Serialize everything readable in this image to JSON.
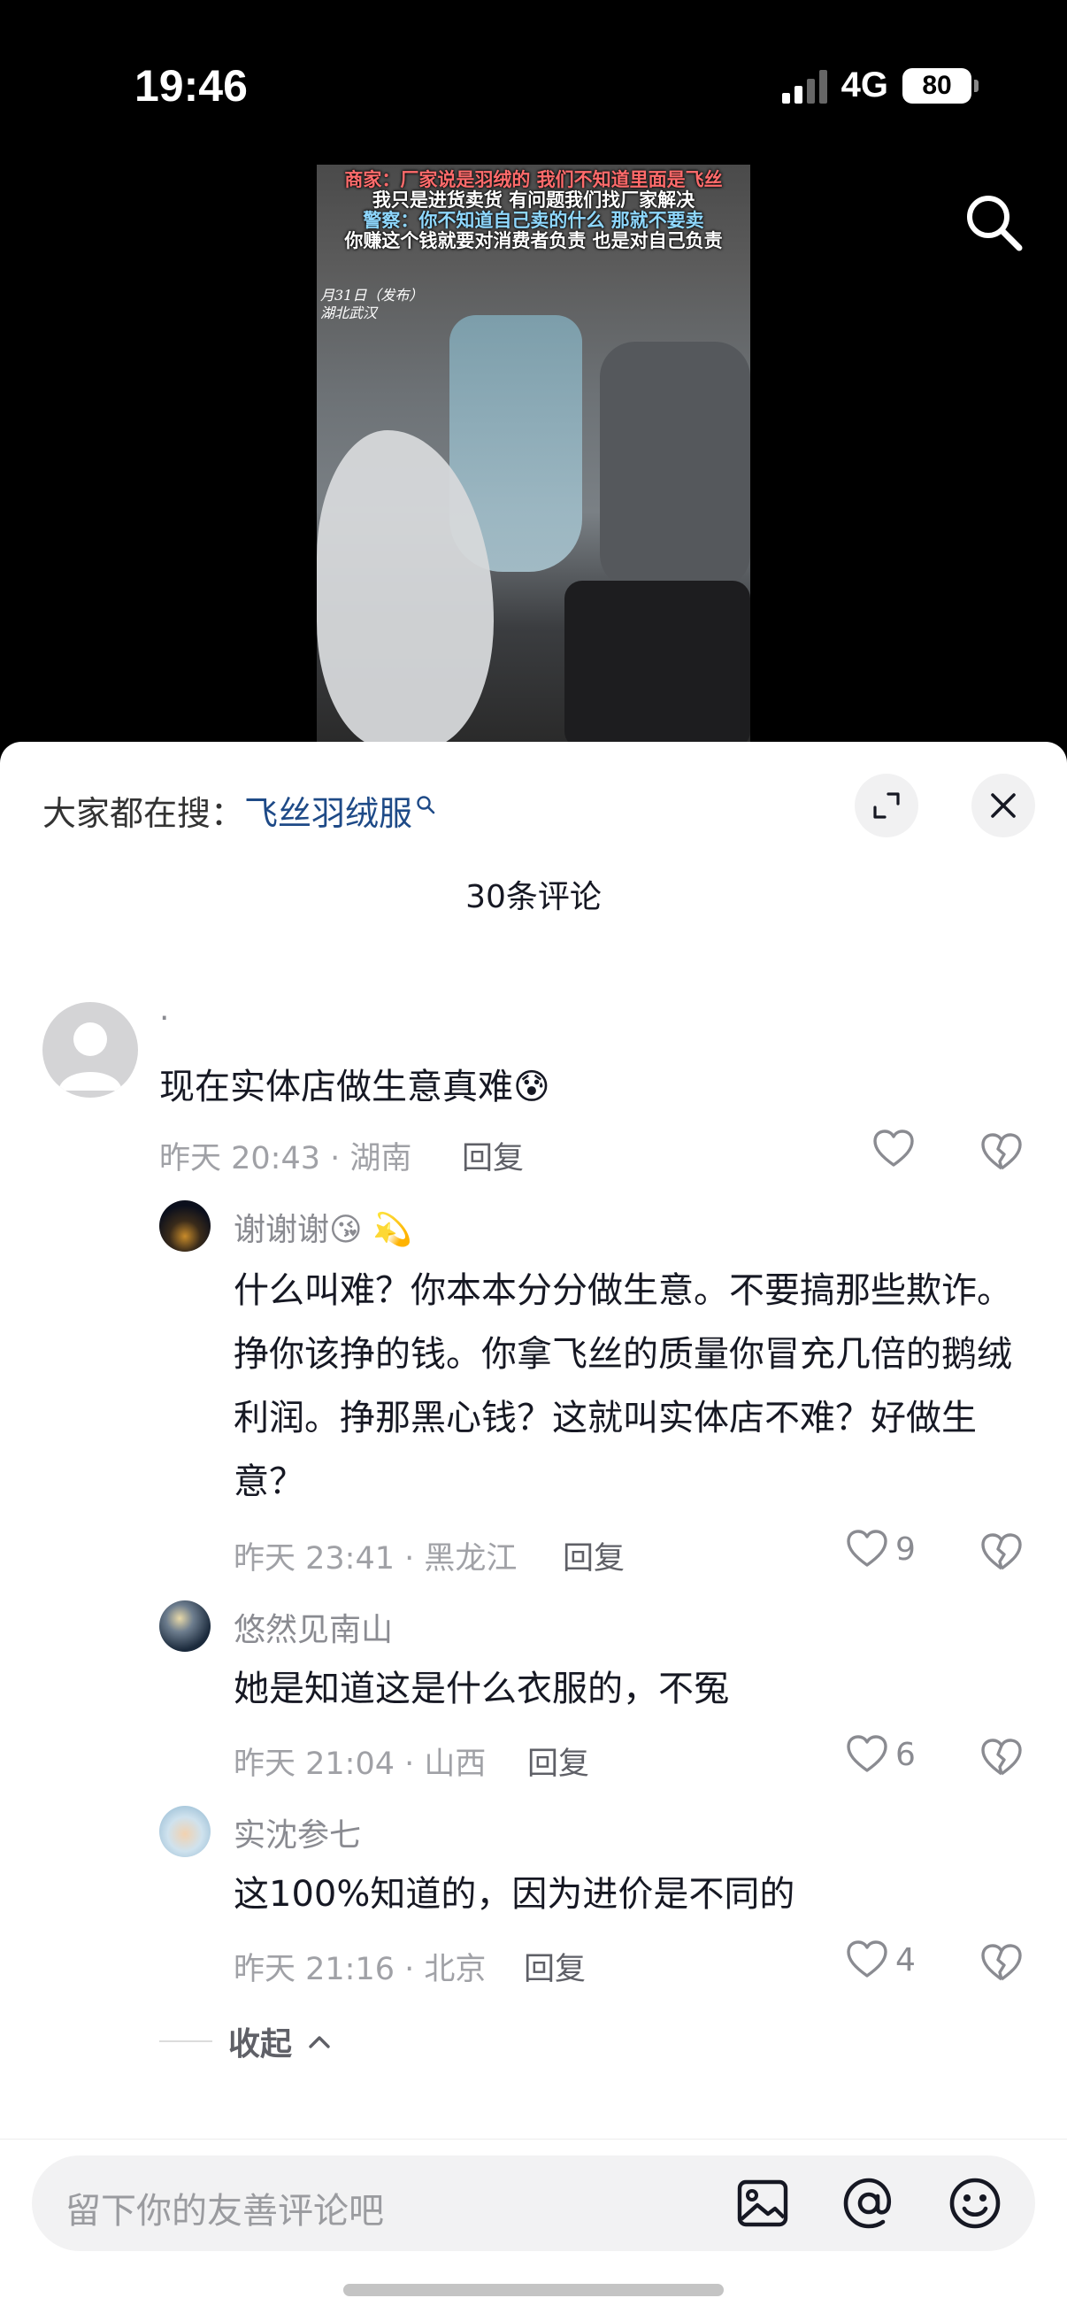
{
  "status": {
    "time": "19:46",
    "network": "4G",
    "battery": "80"
  },
  "video": {
    "caption_lines": [
      "商家：厂家说是羽绒的 我们不知道里面是飞丝",
      "我只是进货卖货 有问题我们找厂家解决",
      "警察：你不知道自己卖的什么 那就不要卖",
      "你赚这个钱就要对消费者负责 也是对自己负责"
    ],
    "stamp_date": "月31日（发布）",
    "stamp_place": "湖北武汉"
  },
  "sheet": {
    "trending_prefix": "大家都在搜：",
    "trending_keyword": "飞丝羽绒服",
    "comment_count": "30条评论",
    "collapse_label": "收起",
    "reply_label": "回复"
  },
  "comments": [
    {
      "user": "·",
      "text": "现在实体店做生意真难😰",
      "time": "昨天 20:43 · 湖南",
      "likes": ""
    },
    {
      "user": "谢谢谢😘 💫",
      "text": "什么叫难？你本本分分做生意。不要搞那些欺诈。挣你该挣的钱。你拿飞丝的质量你冒充几倍的鹅绒利润。挣那黑心钱？这就叫实体店不难？好做生意？",
      "time": "昨天 23:41 · 黑龙江",
      "likes": "9"
    },
    {
      "user": "悠然见南山",
      "text": "她是知道这是什么衣服的，不冤",
      "time": "昨天 21:04 · 山西",
      "likes": "6"
    },
    {
      "user": "实沈参七",
      "text": "这100%知道的，因为进价是不同的",
      "time": "昨天 21:16 · 北京",
      "likes": "4"
    }
  ],
  "input": {
    "placeholder": "留下你的友善评论吧"
  },
  "icons": [
    "search-icon",
    "expand-icon",
    "close-icon",
    "heart-icon",
    "broken-heart-icon",
    "image-icon",
    "at-icon",
    "emoji-icon",
    "chevron-up-icon"
  ]
}
